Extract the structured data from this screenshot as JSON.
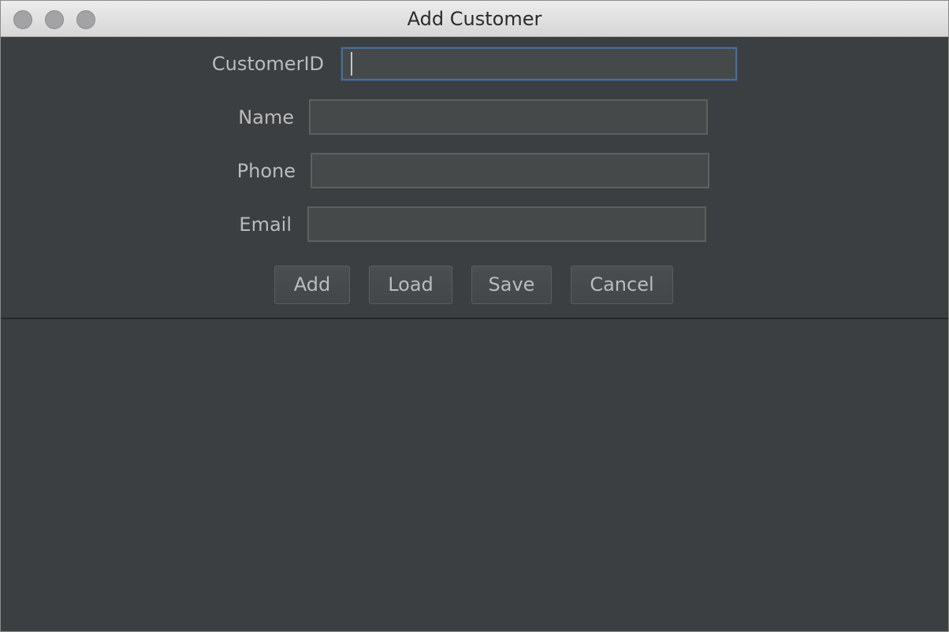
{
  "window": {
    "title": "Add Customer"
  },
  "form": {
    "customer_id": {
      "label": "CustomerID",
      "value": ""
    },
    "name": {
      "label": "Name",
      "value": ""
    },
    "phone": {
      "label": "Phone",
      "value": ""
    },
    "email": {
      "label": "Email",
      "value": ""
    }
  },
  "buttons": {
    "add": "Add",
    "load": "Load",
    "save": "Save",
    "cancel": "Cancel"
  },
  "colors": {
    "panel_background": "#3c3f41",
    "field_background": "#45494a",
    "focus_border": "#4a6d96",
    "text": "#bbbbbb"
  }
}
